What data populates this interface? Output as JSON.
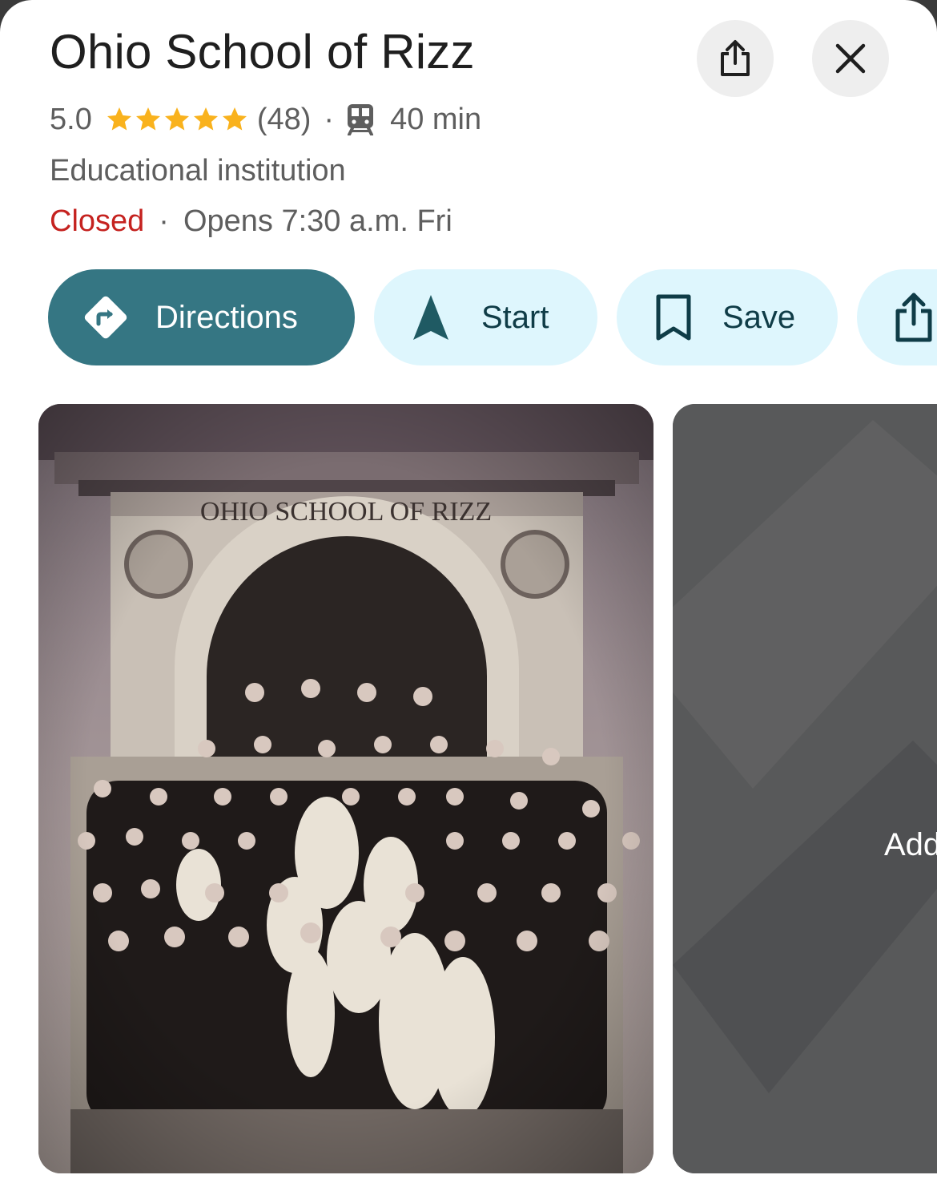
{
  "place": {
    "name": "Ohio School of Rizz",
    "rating": "5.0",
    "review_count": "(48)",
    "separator": "·",
    "transit_time": "40 min",
    "category": "Educational institution",
    "status": "Closed",
    "status_separator": "·",
    "hours": "Opens 7:30 a.m. Fri",
    "stars_filled": 5
  },
  "actions": {
    "directions_label": "Directions",
    "start_label": "Start",
    "save_label": "Save"
  },
  "photos": {
    "engraving": "OHIO SCHOOL OF RIZZ",
    "add_photo_label": "Add"
  },
  "icons": {
    "header_share": "share-icon",
    "close": "close-icon",
    "star": "star-icon",
    "transit": "train-icon",
    "directions": "directions-icon",
    "start": "navigation-arrow-icon",
    "save": "bookmark-icon",
    "share": "share-icon"
  },
  "colors": {
    "accent": "#357683",
    "chip_bg": "#def6fd",
    "chip_text": "#0f3c47",
    "star": "#f9b21d",
    "closed": "#c5221f"
  }
}
